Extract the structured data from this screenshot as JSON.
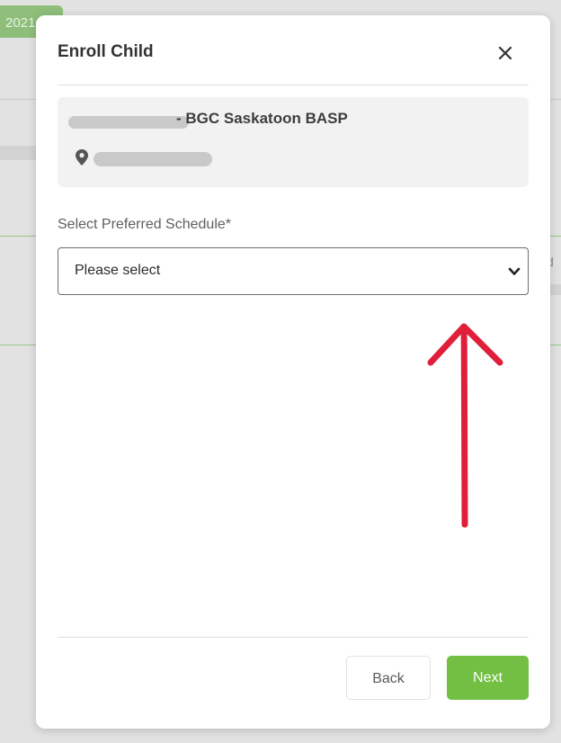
{
  "background": {
    "tab_text": "2021",
    "right_text": "d"
  },
  "modal": {
    "title": "Enroll Child",
    "close_icon": "close-icon"
  },
  "program": {
    "name": "- BGC Saskatoon BASP",
    "location_icon": "map-pin-icon"
  },
  "schedule": {
    "label": "Select Preferred Schedule*",
    "value": "Please select",
    "chevron_icon": "chevron-down-icon"
  },
  "footer": {
    "back_label": "Back",
    "next_label": "Next"
  },
  "colors": {
    "next_button": "#72bf44",
    "annotation_arrow": "#e0203a"
  }
}
